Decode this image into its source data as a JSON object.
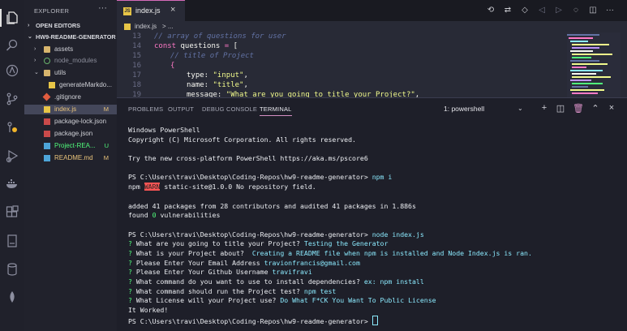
{
  "explorer": {
    "title": "EXPLORER",
    "more": "···",
    "open_editors": "OPEN EDITORS",
    "project": "HW9-README-GENERATOR",
    "items": [
      {
        "label": "assets",
        "badge": ""
      },
      {
        "label": "node_modules",
        "badge": ""
      },
      {
        "label": "utils",
        "badge": ""
      },
      {
        "label": "generateMarkdo...",
        "badge": ""
      },
      {
        "label": ".gitignore",
        "badge": ""
      },
      {
        "label": "index.js",
        "badge": "M"
      },
      {
        "label": "package-lock.json",
        "badge": ""
      },
      {
        "label": "package.json",
        "badge": ""
      },
      {
        "label": "Project-REA...",
        "badge": "U"
      },
      {
        "label": "README.md",
        "badge": "M"
      }
    ]
  },
  "editor": {
    "tab_label": "index.js",
    "tab_icon_text": "JS",
    "breadcrumb_file": "index.js",
    "breadcrumb_rest": "> ...",
    "code": {
      "line_numbers": [
        "13",
        "14",
        "15",
        "16",
        "17",
        "18",
        "19"
      ],
      "l13": "// array of questions for user",
      "l14_kw": "const",
      "l14_id": "questions",
      "l14_op": "=",
      "l14_br": "[",
      "l15": "// title of Project",
      "l16": "{",
      "l17_key": "type:",
      "l17_str": "\"input\"",
      "l17_end": ",",
      "l18_key": "name:",
      "l18_str": "\"title\"",
      "l18_end": ",",
      "l19_key": "message:",
      "l19_str": "\"What are you going to title your Project?\"",
      "l19_end": ","
    }
  },
  "panel": {
    "tabs": [
      "PROBLEMS",
      "OUTPUT",
      "DEBUG CONSOLE",
      "TERMINAL"
    ],
    "active_tab": "TERMINAL",
    "terminal_select": "1: powershell",
    "terminal_lines": {
      "l1": "Windows PowerShell",
      "l2": "Copyright (C) Microsoft Corporation. All rights reserved.",
      "l3": "Try the new cross-platform PowerShell https://aka.ms/pscore6",
      "prompt": "PS C:\\Users\\travi\\Desktop\\Coding-Repos\\hw9-readme-generator> ",
      "cmd1": "npm i",
      "npm": "npm ",
      "warn": "WARN",
      "warn_rest": " static-site@1.0.0 No repository field.",
      "added": "added 41 packages from 28 contributors and audited 41 packages in 1.886s",
      "found_a": "found ",
      "found_num": "0",
      "found_b": " vulnerabilities",
      "cmd2": "node index.js",
      "q1": "? ",
      "q1t": "What are you going to title your Project? ",
      "a1": "Testing the Generator",
      "q2t": "What is your Project about? ",
      "a2": " Creating a README file when npm is installed and Node Index.js is ran.",
      "q3t": "Please Enter Your Email Address ",
      "a3": "travionfrancis@gmail.com",
      "q4t": "Please Enter Your Github Username ",
      "a4": "travifravi",
      "q5t": "What command do you want to use to install dependencies? ",
      "a5": "ex: npm install",
      "q6t": "What command should run the Project test? ",
      "a6": "npm test",
      "q7t": "What License will your Project use? ",
      "a7": "Do What F*CK You Want To Public License",
      "done": "It Worked!"
    }
  },
  "colors": {
    "accent": "#d56ab9",
    "sidebar_bg": "#21222c",
    "editor_bg": "#282a36",
    "terminal_bg": "#1e1f29"
  }
}
